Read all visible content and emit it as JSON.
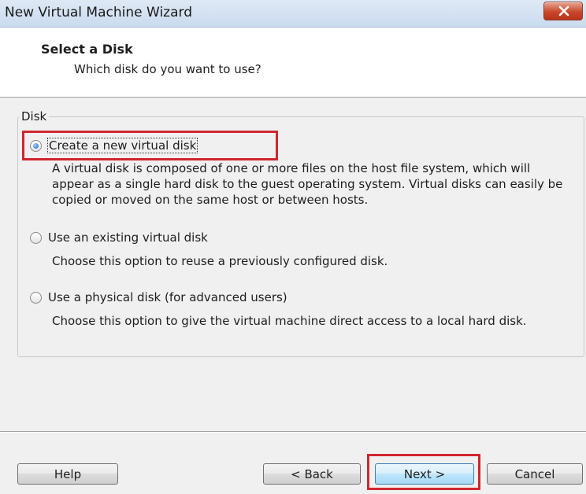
{
  "window": {
    "title": "New Virtual Machine Wizard",
    "close_icon": "close-icon"
  },
  "header": {
    "title": "Select a Disk",
    "subtitle": "Which disk do you want to use?"
  },
  "disk_group": {
    "legend": "Disk",
    "options": [
      {
        "label": "Create a new virtual disk",
        "selected": true,
        "description": "A virtual disk is composed of one or more files on the host file system, which will appear as a single hard disk to the guest operating system. Virtual disks can easily be copied or moved on the same host or between hosts."
      },
      {
        "label": "Use an existing virtual disk",
        "selected": false,
        "description": "Choose this option to reuse a previously configured disk."
      },
      {
        "label": "Use a physical disk (for advanced users)",
        "selected": false,
        "description": "Choose this option to give the virtual machine direct access to a local hard disk."
      }
    ]
  },
  "buttons": {
    "help": "Help",
    "back": "< Back",
    "next": "Next >",
    "cancel": "Cancel"
  },
  "colors": {
    "highlight": "#d0262e",
    "radio_selected": "#1e63c2"
  }
}
